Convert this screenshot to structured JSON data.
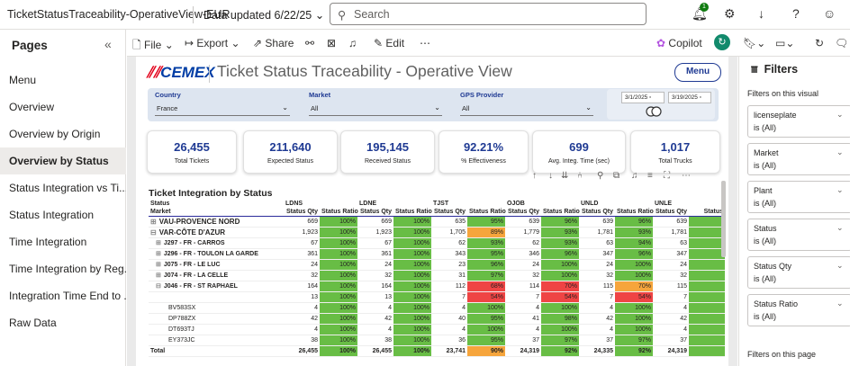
{
  "app": {
    "report_name": "TicketStatusTraceability-OperativeView-EUR",
    "data_updated": "Data updated 6/22/25",
    "search_placeholder": "Search",
    "notification_count": "1"
  },
  "leftnav": {
    "header": "Pages",
    "collapse_icon": "«",
    "items": [
      {
        "label": "Menu"
      },
      {
        "label": "Overview"
      },
      {
        "label": "Overview by Origin"
      },
      {
        "label": "Overview by Status"
      },
      {
        "label": "Status Integration vs Ti..."
      },
      {
        "label": "Status Integration"
      },
      {
        "label": "Time Integration"
      },
      {
        "label": "Time Integration by Reg..."
      },
      {
        "label": "Integration Time End to ..."
      },
      {
        "label": "Raw Data"
      }
    ]
  },
  "toolbar": {
    "file": "File",
    "export": "Export",
    "share": "Share",
    "edit": "Edit",
    "copilot": "Copilot"
  },
  "report": {
    "brand": "CEMEX",
    "title": "Ticket Status Traceability - Operative View",
    "menu_button": "Menu",
    "filters": {
      "country_label": "Country",
      "country_value": "France",
      "market_label": "Market",
      "market_value": "All",
      "gps_label": "GPS Provider",
      "gps_value": "All",
      "date_from": "3/1/2025",
      "date_to": "3/19/2025"
    },
    "kpis": [
      {
        "value": "26,455",
        "label": "Total Tickets"
      },
      {
        "value": "211,640",
        "label": "Expected Status"
      },
      {
        "value": "195,145",
        "label": "Received Status"
      },
      {
        "value": "92.21%",
        "label": "% Effectiveness"
      },
      {
        "value": "699",
        "label": "Avg. Integ. Time (sec)"
      },
      {
        "value": "1,017",
        "label": "Total Trucks"
      }
    ],
    "matrix": {
      "title": "Ticket Integration by Status",
      "row_header_1": "Status",
      "row_header_2": "Market",
      "groups": [
        "LDNS",
        "LDNE",
        "TJST",
        "OJOB",
        "UNLD",
        "UNLE"
      ],
      "qty_label": "Status Qty",
      "ratio_label": "Status Ratio",
      "last_col": "Status",
      "rows": [
        {
          "name": "VAU-PROVENCE NORD",
          "lvl": "lvl0",
          "expander": "⊞",
          "cells": [
            [
              "669",
              "100%",
              "g"
            ],
            [
              "669",
              "100%",
              "g"
            ],
            [
              "635",
              "95%",
              "g"
            ],
            [
              "639",
              "96%",
              "g"
            ],
            [
              "639",
              "96%",
              "g"
            ],
            [
              "639",
              ""
            ]
          ]
        },
        {
          "name": "VAR-CÔTE D'AZUR",
          "lvl": "lvl0",
          "expander": "⊟",
          "cells": [
            [
              "1,923",
              "100%",
              "g"
            ],
            [
              "1,923",
              "100%",
              "g"
            ],
            [
              "1,705",
              "89%",
              "o"
            ],
            [
              "1,779",
              "93%",
              "g"
            ],
            [
              "1,781",
              "93%",
              "g"
            ],
            [
              "1,781",
              ""
            ]
          ]
        },
        {
          "name": "J297 - FR - CARROS",
          "lvl": "lvl1",
          "expander": "⊞",
          "cells": [
            [
              "67",
              "100%",
              "g"
            ],
            [
              "67",
              "100%",
              "g"
            ],
            [
              "62",
              "93%",
              "g"
            ],
            [
              "62",
              "93%",
              "g"
            ],
            [
              "63",
              "94%",
              "g"
            ],
            [
              "63",
              ""
            ]
          ]
        },
        {
          "name": "J296 - FR - TOULON LA GARDE",
          "lvl": "lvl1",
          "expander": "⊞",
          "cells": [
            [
              "361",
              "100%",
              "g"
            ],
            [
              "361",
              "100%",
              "g"
            ],
            [
              "343",
              "95%",
              "g"
            ],
            [
              "346",
              "96%",
              "g"
            ],
            [
              "347",
              "96%",
              "g"
            ],
            [
              "347",
              ""
            ]
          ]
        },
        {
          "name": "J075 - FR - LE LUC",
          "lvl": "lvl1",
          "expander": "⊞",
          "cells": [
            [
              "24",
              "100%",
              "g"
            ],
            [
              "24",
              "100%",
              "g"
            ],
            [
              "23",
              "96%",
              "g"
            ],
            [
              "24",
              "100%",
              "g"
            ],
            [
              "24",
              "100%",
              "g"
            ],
            [
              "24",
              ""
            ]
          ]
        },
        {
          "name": "J074 - FR - LA CELLE",
          "lvl": "lvl1",
          "expander": "⊞",
          "cells": [
            [
              "32",
              "100%",
              "g"
            ],
            [
              "32",
              "100%",
              "g"
            ],
            [
              "31",
              "97%",
              "g"
            ],
            [
              "32",
              "100%",
              "g"
            ],
            [
              "32",
              "100%",
              "g"
            ],
            [
              "32",
              ""
            ]
          ]
        },
        {
          "name": "J046 - FR - ST RAPHAEL",
          "lvl": "lvl1",
          "expander": "⊟",
          "cells": [
            [
              "164",
              "100%",
              "g"
            ],
            [
              "164",
              "100%",
              "g"
            ],
            [
              "112",
              "68%",
              "r"
            ],
            [
              "114",
              "70%",
              "r"
            ],
            [
              "115",
              "70%",
              "o"
            ],
            [
              "115",
              ""
            ]
          ]
        },
        {
          "name": "",
          "lvl": "leaf",
          "expander": "",
          "cells": [
            [
              "13",
              "100%",
              "g"
            ],
            [
              "13",
              "100%",
              "g"
            ],
            [
              "7",
              "54%",
              "r"
            ],
            [
              "7",
              "54%",
              "r"
            ],
            [
              "7",
              "54%",
              "r"
            ],
            [
              "7",
              ""
            ]
          ]
        },
        {
          "name": "BV583SX",
          "lvl": "leaf",
          "expander": "",
          "cells": [
            [
              "4",
              "100%",
              "g"
            ],
            [
              "4",
              "100%",
              "g"
            ],
            [
              "4",
              "100%",
              "g"
            ],
            [
              "4",
              "100%",
              "g"
            ],
            [
              "4",
              "100%",
              "g"
            ],
            [
              "4",
              ""
            ]
          ]
        },
        {
          "name": "DP788ZX",
          "lvl": "leaf",
          "expander": "",
          "cells": [
            [
              "42",
              "100%",
              "g"
            ],
            [
              "42",
              "100%",
              "g"
            ],
            [
              "40",
              "95%",
              "g"
            ],
            [
              "41",
              "98%",
              "g"
            ],
            [
              "42",
              "100%",
              "g"
            ],
            [
              "42",
              ""
            ]
          ]
        },
        {
          "name": "DT693TJ",
          "lvl": "leaf",
          "expander": "",
          "cells": [
            [
              "4",
              "100%",
              "g"
            ],
            [
              "4",
              "100%",
              "g"
            ],
            [
              "4",
              "100%",
              "g"
            ],
            [
              "4",
              "100%",
              "g"
            ],
            [
              "4",
              "100%",
              "g"
            ],
            [
              "4",
              ""
            ]
          ]
        },
        {
          "name": "EY373JC",
          "lvl": "leaf",
          "expander": "",
          "cells": [
            [
              "38",
              "100%",
              "g"
            ],
            [
              "38",
              "100%",
              "g"
            ],
            [
              "36",
              "95%",
              "g"
            ],
            [
              "37",
              "97%",
              "g"
            ],
            [
              "37",
              "97%",
              "g"
            ],
            [
              "37",
              ""
            ]
          ]
        }
      ],
      "total": {
        "name": "Total",
        "cells": [
          [
            "26,455",
            "100%",
            "g"
          ],
          [
            "26,455",
            "100%",
            "g"
          ],
          [
            "23,741",
            "90%",
            "o"
          ],
          [
            "24,319",
            "92%",
            "g"
          ],
          [
            "24,335",
            "92%",
            "g"
          ],
          [
            "24,319",
            ""
          ]
        ]
      }
    }
  },
  "filters_pane": {
    "title": "Filters",
    "on_visual": "Filters on this visual",
    "on_page": "Filters on this page",
    "cards": [
      {
        "name": "licenseplate",
        "state": "is (All)"
      },
      {
        "name": "Market",
        "state": "is (All)"
      },
      {
        "name": "Plant",
        "state": "is (All)"
      },
      {
        "name": "Status",
        "state": "is (All)"
      },
      {
        "name": "Status Qty",
        "state": "is (All)"
      },
      {
        "name": "Status Ratio",
        "state": "is (All)"
      }
    ]
  },
  "colors": {
    "accent_blue": "#1f3a93",
    "good": "#68bd45",
    "bad": "#ef4444",
    "warn": "#f6a53c",
    "cemex_red": "#e2001a"
  }
}
